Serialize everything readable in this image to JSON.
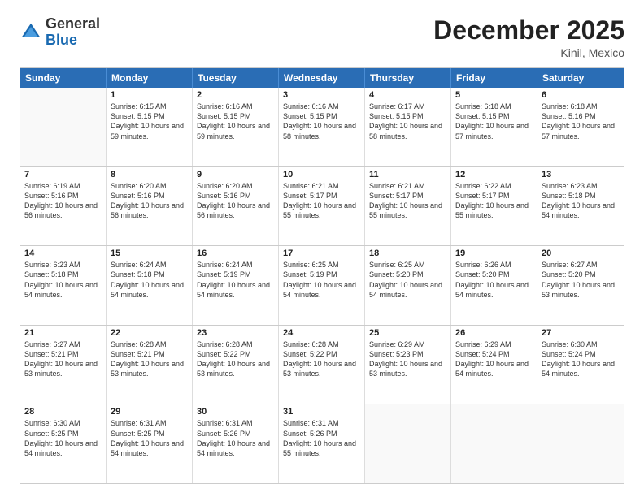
{
  "logo": {
    "general": "General",
    "blue": "Blue"
  },
  "header": {
    "month": "December 2025",
    "location": "Kinil, Mexico"
  },
  "weekdays": [
    "Sunday",
    "Monday",
    "Tuesday",
    "Wednesday",
    "Thursday",
    "Friday",
    "Saturday"
  ],
  "weeks": [
    [
      {
        "day": null
      },
      {
        "day": "1",
        "sunrise": "6:15 AM",
        "sunset": "5:15 PM",
        "daylight": "10 hours and 59 minutes."
      },
      {
        "day": "2",
        "sunrise": "6:16 AM",
        "sunset": "5:15 PM",
        "daylight": "10 hours and 59 minutes."
      },
      {
        "day": "3",
        "sunrise": "6:16 AM",
        "sunset": "5:15 PM",
        "daylight": "10 hours and 58 minutes."
      },
      {
        "day": "4",
        "sunrise": "6:17 AM",
        "sunset": "5:15 PM",
        "daylight": "10 hours and 58 minutes."
      },
      {
        "day": "5",
        "sunrise": "6:18 AM",
        "sunset": "5:15 PM",
        "daylight": "10 hours and 57 minutes."
      },
      {
        "day": "6",
        "sunrise": "6:18 AM",
        "sunset": "5:16 PM",
        "daylight": "10 hours and 57 minutes."
      }
    ],
    [
      {
        "day": "7",
        "sunrise": "6:19 AM",
        "sunset": "5:16 PM",
        "daylight": "10 hours and 56 minutes."
      },
      {
        "day": "8",
        "sunrise": "6:20 AM",
        "sunset": "5:16 PM",
        "daylight": "10 hours and 56 minutes."
      },
      {
        "day": "9",
        "sunrise": "6:20 AM",
        "sunset": "5:16 PM",
        "daylight": "10 hours and 56 minutes."
      },
      {
        "day": "10",
        "sunrise": "6:21 AM",
        "sunset": "5:17 PM",
        "daylight": "10 hours and 55 minutes."
      },
      {
        "day": "11",
        "sunrise": "6:21 AM",
        "sunset": "5:17 PM",
        "daylight": "10 hours and 55 minutes."
      },
      {
        "day": "12",
        "sunrise": "6:22 AM",
        "sunset": "5:17 PM",
        "daylight": "10 hours and 55 minutes."
      },
      {
        "day": "13",
        "sunrise": "6:23 AM",
        "sunset": "5:18 PM",
        "daylight": "10 hours and 54 minutes."
      }
    ],
    [
      {
        "day": "14",
        "sunrise": "6:23 AM",
        "sunset": "5:18 PM",
        "daylight": "10 hours and 54 minutes."
      },
      {
        "day": "15",
        "sunrise": "6:24 AM",
        "sunset": "5:18 PM",
        "daylight": "10 hours and 54 minutes."
      },
      {
        "day": "16",
        "sunrise": "6:24 AM",
        "sunset": "5:19 PM",
        "daylight": "10 hours and 54 minutes."
      },
      {
        "day": "17",
        "sunrise": "6:25 AM",
        "sunset": "5:19 PM",
        "daylight": "10 hours and 54 minutes."
      },
      {
        "day": "18",
        "sunrise": "6:25 AM",
        "sunset": "5:20 PM",
        "daylight": "10 hours and 54 minutes."
      },
      {
        "day": "19",
        "sunrise": "6:26 AM",
        "sunset": "5:20 PM",
        "daylight": "10 hours and 54 minutes."
      },
      {
        "day": "20",
        "sunrise": "6:27 AM",
        "sunset": "5:20 PM",
        "daylight": "10 hours and 53 minutes."
      }
    ],
    [
      {
        "day": "21",
        "sunrise": "6:27 AM",
        "sunset": "5:21 PM",
        "daylight": "10 hours and 53 minutes."
      },
      {
        "day": "22",
        "sunrise": "6:28 AM",
        "sunset": "5:21 PM",
        "daylight": "10 hours and 53 minutes."
      },
      {
        "day": "23",
        "sunrise": "6:28 AM",
        "sunset": "5:22 PM",
        "daylight": "10 hours and 53 minutes."
      },
      {
        "day": "24",
        "sunrise": "6:28 AM",
        "sunset": "5:22 PM",
        "daylight": "10 hours and 53 minutes."
      },
      {
        "day": "25",
        "sunrise": "6:29 AM",
        "sunset": "5:23 PM",
        "daylight": "10 hours and 53 minutes."
      },
      {
        "day": "26",
        "sunrise": "6:29 AM",
        "sunset": "5:24 PM",
        "daylight": "10 hours and 54 minutes."
      },
      {
        "day": "27",
        "sunrise": "6:30 AM",
        "sunset": "5:24 PM",
        "daylight": "10 hours and 54 minutes."
      }
    ],
    [
      {
        "day": "28",
        "sunrise": "6:30 AM",
        "sunset": "5:25 PM",
        "daylight": "10 hours and 54 minutes."
      },
      {
        "day": "29",
        "sunrise": "6:31 AM",
        "sunset": "5:25 PM",
        "daylight": "10 hours and 54 minutes."
      },
      {
        "day": "30",
        "sunrise": "6:31 AM",
        "sunset": "5:26 PM",
        "daylight": "10 hours and 54 minutes."
      },
      {
        "day": "31",
        "sunrise": "6:31 AM",
        "sunset": "5:26 PM",
        "daylight": "10 hours and 55 minutes."
      },
      {
        "day": null
      },
      {
        "day": null
      },
      {
        "day": null
      }
    ]
  ]
}
